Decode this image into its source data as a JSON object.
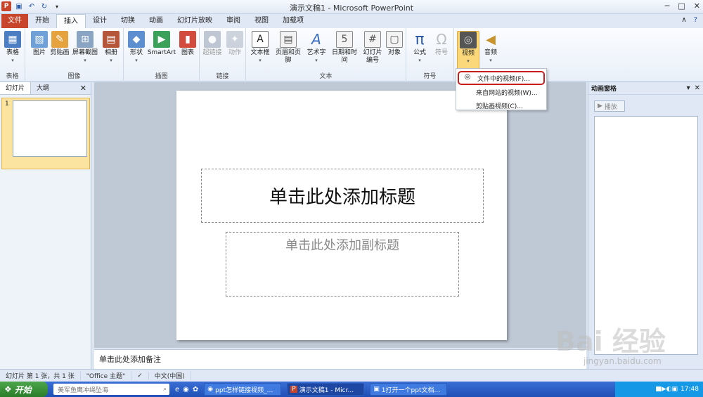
{
  "window": {
    "title": "演示文稿1 - Microsoft PowerPoint",
    "app_logo": "P",
    "minimize": "─",
    "maximize": "□",
    "close": "✕"
  },
  "qat": {
    "save_icon": "save-icon",
    "undo_icon": "undo-icon",
    "redo_icon": "redo-icon"
  },
  "tabs": [
    {
      "label": "文件"
    },
    {
      "label": "开始"
    },
    {
      "label": "插入"
    },
    {
      "label": "设计"
    },
    {
      "label": "切换"
    },
    {
      "label": "动画"
    },
    {
      "label": "幻灯片放映"
    },
    {
      "label": "审阅"
    },
    {
      "label": "视图"
    },
    {
      "label": "加载项"
    }
  ],
  "ribbon": {
    "groups": [
      {
        "label": "表格",
        "buttons": [
          {
            "label": "表格"
          }
        ]
      },
      {
        "label": "图像",
        "buttons": [
          {
            "label": "图片"
          },
          {
            "label": "剪贴画"
          },
          {
            "label": "屏幕截图"
          },
          {
            "label": "相册"
          }
        ]
      },
      {
        "label": "插图",
        "buttons": [
          {
            "label": "形状"
          },
          {
            "label": "SmartArt"
          },
          {
            "label": "图表"
          }
        ]
      },
      {
        "label": "链接",
        "buttons": [
          {
            "label": "超链接"
          },
          {
            "label": "动作"
          }
        ]
      },
      {
        "label": "文本",
        "buttons": [
          {
            "label": "文本框"
          },
          {
            "label": "页眉和页脚"
          },
          {
            "label": "艺术字"
          },
          {
            "label": "日期和时间"
          },
          {
            "label": "幻灯片"
          },
          {
            "label": "对象"
          }
        ]
      },
      {
        "label": "符号",
        "buttons": [
          {
            "label": "公式"
          },
          {
            "label": "符号"
          }
        ]
      },
      {
        "label": "",
        "buttons": [
          {
            "label": "视频"
          },
          {
            "label": "音频"
          }
        ]
      }
    ],
    "slide_number_line2": "编号"
  },
  "video_dropdown": {
    "items": [
      {
        "label": "文件中的视频(F)..."
      },
      {
        "label": "来自网站的视频(W)..."
      },
      {
        "label": "剪贴画视频(C)..."
      }
    ]
  },
  "left_panel": {
    "tabs": [
      {
        "label": "幻灯片"
      },
      {
        "label": "大纲"
      }
    ],
    "close": "✕",
    "slide_number": "1"
  },
  "slide": {
    "title_placeholder": "单击此处添加标题",
    "subtitle_placeholder": "单击此处添加副标题"
  },
  "notes": {
    "placeholder": "单击此处添加备注"
  },
  "right_panel": {
    "title": "动画窗格",
    "play_label": "播放",
    "close": "✕"
  },
  "status_bar": {
    "slide_info": "幻灯片 第 1 张，共 1 张",
    "theme": "\"Office 主题\"",
    "language": "中文(中国)"
  },
  "taskbar": {
    "start_label": "开始",
    "search_text": "美军鱼鹰冲绳坠海",
    "tasks": [
      {
        "label": "ppt怎样链接视频_..."
      },
      {
        "label": "演示文稿1 - Micr..."
      },
      {
        "label": "1打开一个ppt文档..."
      }
    ],
    "clock": "17:48"
  },
  "watermark": {
    "text": "Bai 经验",
    "sub": "jingyan.baidu.com"
  },
  "colors": {
    "file_tab": "#c8452b",
    "highlight": "#fbd97b",
    "dropdown_outline": "#c81e1e",
    "taskbar": "#1f4fb5"
  }
}
